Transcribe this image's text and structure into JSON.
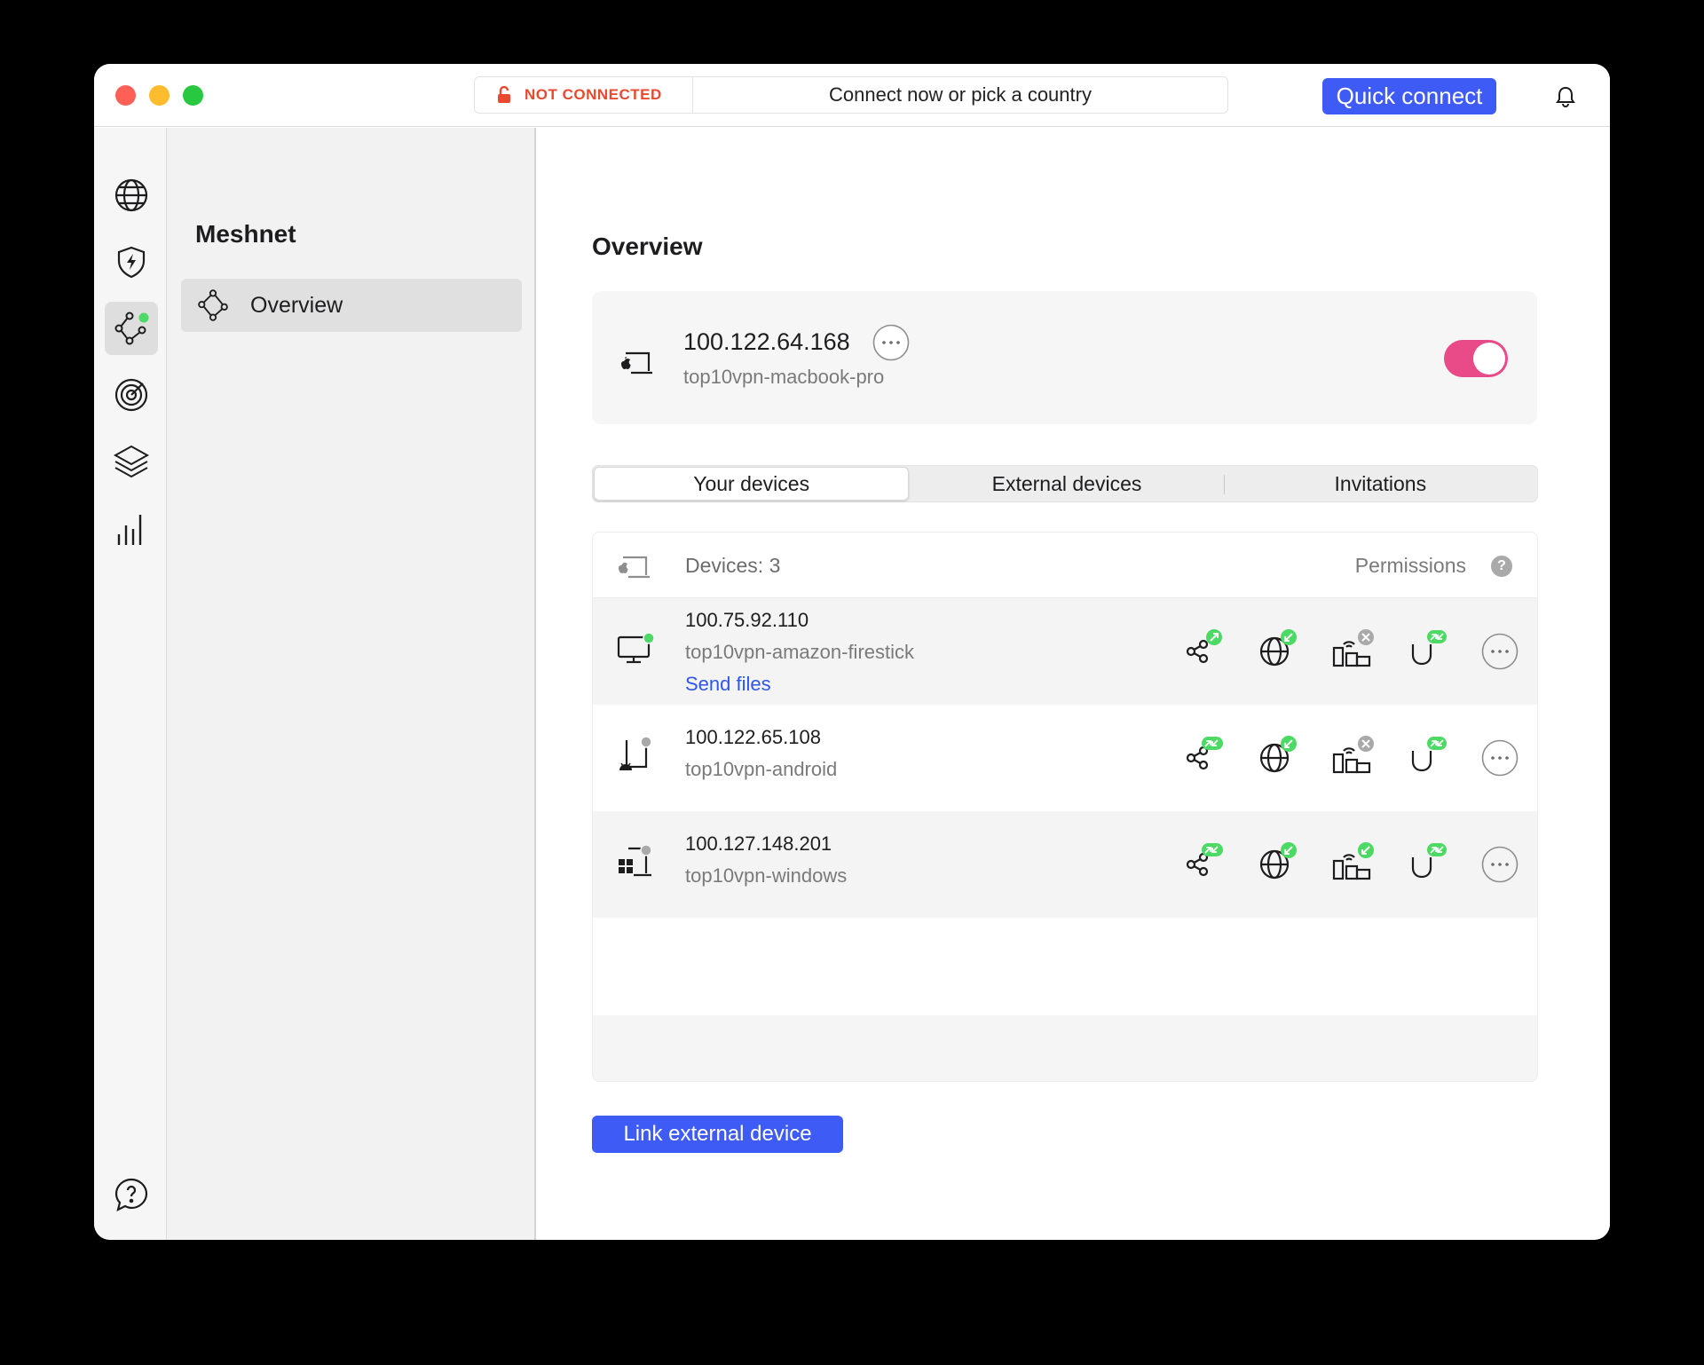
{
  "titlebar": {
    "status": "NOT CONNECTED",
    "prompt": "Connect now or pick a country",
    "quick_connect": "Quick connect"
  },
  "rail": {
    "items": [
      "globe-icon",
      "shield-bolt-icon",
      "meshnet-icon",
      "target-icon",
      "layers-icon",
      "stats-icon"
    ],
    "bottom": [
      "help-icon",
      "settings-icon"
    ],
    "active": "meshnet-icon"
  },
  "sidebar": {
    "title": "Meshnet",
    "items": [
      {
        "label": "Overview",
        "icon": "meshnet-icon"
      }
    ]
  },
  "main": {
    "title": "Overview",
    "this_device": {
      "ip": "100.122.64.168",
      "name": "top10vpn-macbook-pro",
      "enabled": true
    },
    "tabs": [
      {
        "label": "Your devices",
        "selected": true
      },
      {
        "label": "External devices",
        "selected": false
      },
      {
        "label": "Invitations",
        "selected": false
      }
    ],
    "devices_header": {
      "count": "Devices: 3",
      "permissions": "Permissions",
      "help": "?"
    },
    "devices": [
      {
        "ip": "100.75.92.110",
        "name": "top10vpn-amazon-firestick",
        "link": "Send files",
        "online": true,
        "type": "tv"
      },
      {
        "ip": "100.122.65.108",
        "name": "top10vpn-android",
        "online": false,
        "type": "android"
      },
      {
        "ip": "100.127.148.201",
        "name": "top10vpn-windows",
        "online": false,
        "type": "windows"
      }
    ],
    "link_external": "Link external device"
  },
  "colors": {
    "accent": "#3e5bf6",
    "toggle_on": "#e94b88",
    "online": "#4cd964",
    "disabled": "#a9a9a9",
    "not_connected": "#e8492f"
  }
}
